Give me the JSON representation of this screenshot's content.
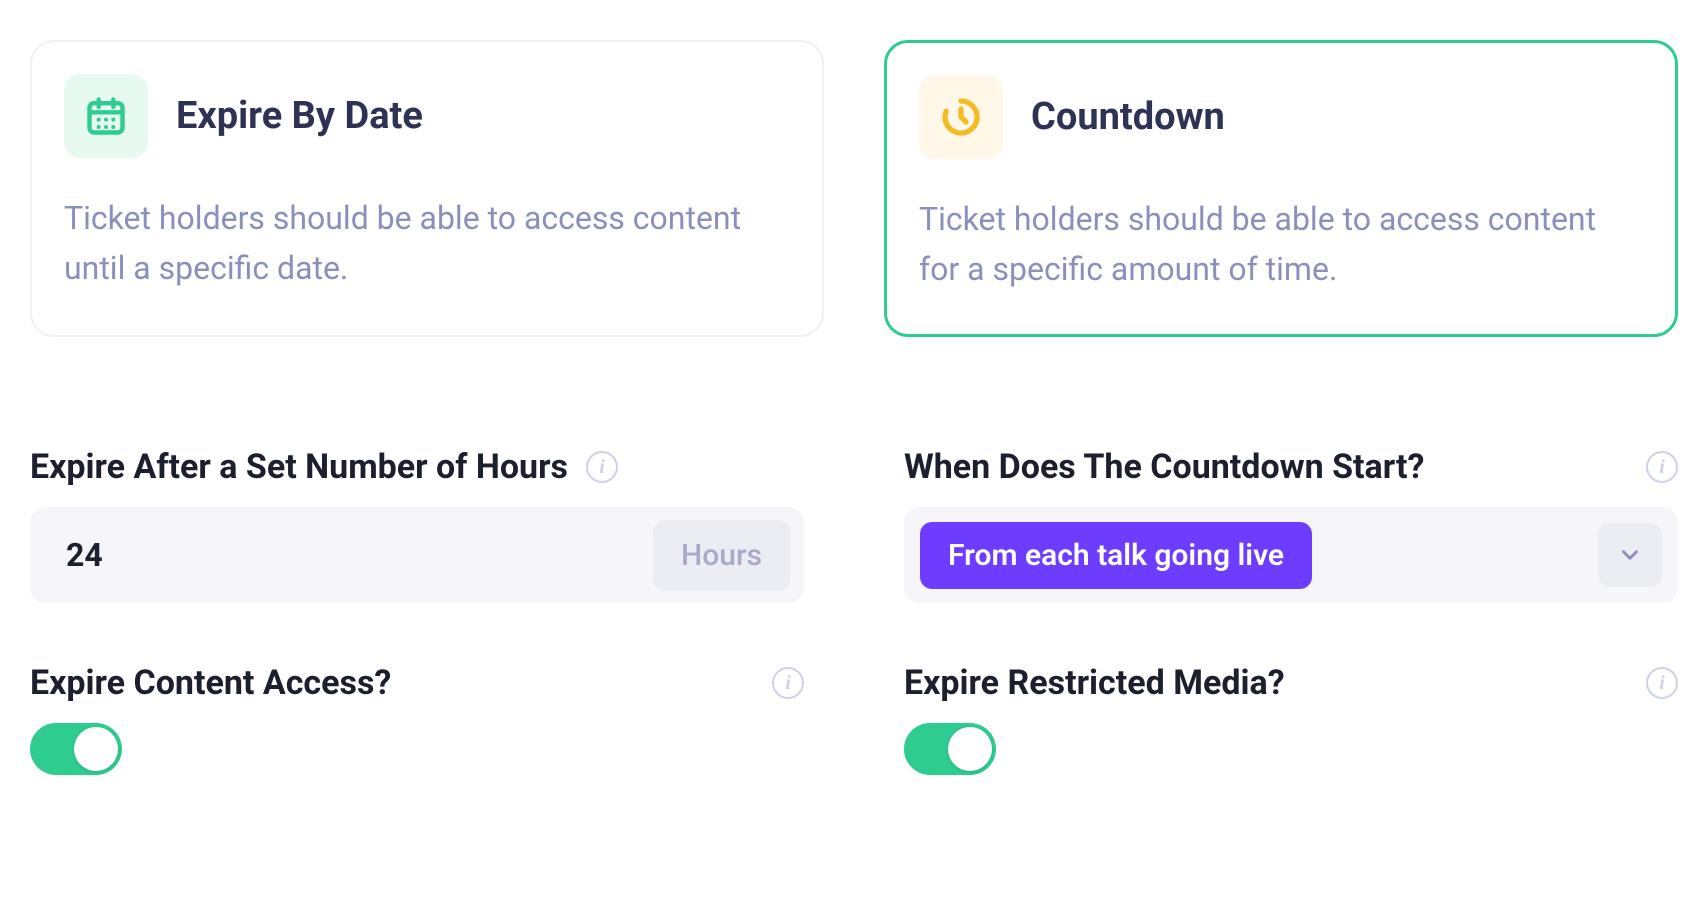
{
  "options": {
    "expire_by_date": {
      "title": "Expire By Date",
      "desc": "Ticket holders should be able to access content until a specific date.",
      "selected": false
    },
    "countdown": {
      "title": "Countdown",
      "desc": "Ticket holders should be able to access content for a specific amount of time.",
      "selected": true
    }
  },
  "hours_field": {
    "label": "Expire After a Set Number of Hours",
    "value": "24",
    "suffix": "Hours"
  },
  "start_field": {
    "label": "When Does The Countdown Start?",
    "selected": "From each talk going live"
  },
  "toggles": {
    "content_access": {
      "label": "Expire Content Access?",
      "on": true
    },
    "restricted_media": {
      "label": "Expire Restricted Media?",
      "on": true
    }
  }
}
